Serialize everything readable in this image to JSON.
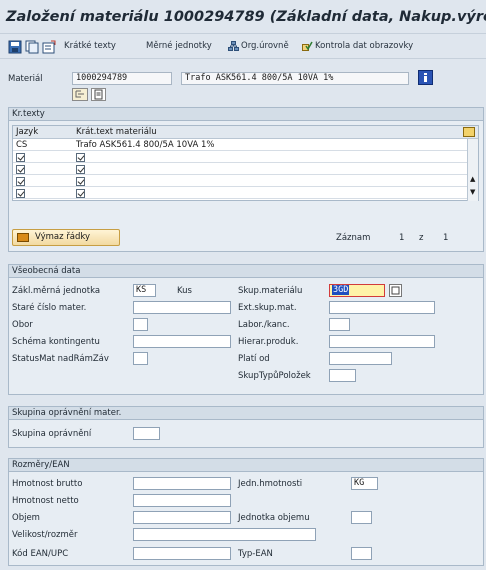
{
  "title": "Založení materiálu 1000294789 (Základní data, Nakup.výrobky a ma",
  "toolbar": {
    "short_texts": "Krátké texty",
    "units": "Měrné jednotky",
    "org_levels": "Org.úrovně",
    "check_screen_data": "Kontrola dat obrazovky"
  },
  "material": {
    "label": "Materiál",
    "number": "1000294789",
    "description": "Trafo ASK561.4 800/5A 10VA  1%"
  },
  "short_texts": {
    "group_title": "Kr.texty",
    "col_language": "Jazyk",
    "col_text": "Krát.text materiálu",
    "rows": [
      {
        "lang": "CS",
        "text": "Trafo ASK561.4 800/5A 10VA  1%"
      },
      {
        "lang": "",
        "text": ""
      },
      {
        "lang": "",
        "text": ""
      },
      {
        "lang": "",
        "text": ""
      }
    ],
    "delete_button": "Výmaz řádky",
    "record_label": "Záznam",
    "record_current": "1",
    "record_of": "z",
    "record_total": "1"
  },
  "general": {
    "group_title": "Všeobecná data",
    "base_uom_label": "Zákl.měrná jednotka",
    "base_uom_value": "KS",
    "base_uom_text": "Kus",
    "old_material_label": "Staré číslo mater.",
    "division_label": "Obor",
    "quota_label": "Schéma kontingentu",
    "status_label": "StatusMat nadRámZáv",
    "material_group_label": "Skup.materiálu",
    "material_group_value": "3GD",
    "ext_group_label": "Ext.skup.mat.",
    "lab_label": "Labor./kanc.",
    "hierarchy_label": "Hierar.produk.",
    "valid_from_label": "Platí od",
    "item_cat_group_label": "SkupTypůPoložek"
  },
  "authorization": {
    "group_title": "Skupina oprávnění mater.",
    "auth_group_label": "Skupina oprávnění"
  },
  "dimensions": {
    "group_title": "Rozměry/EAN",
    "gross_weight_label": "Hmotnost brutto",
    "net_weight_label": "Hmotnost netto",
    "volume_label": "Objem",
    "size_label": "Velikost/rozměr",
    "ean_label": "Kód EAN/UPC",
    "weight_unit_label": "Jedn.hmotnosti",
    "weight_unit_value": "KG",
    "volume_unit_label": "Jednotka objemu",
    "ean_type_label": "Typ-EAN"
  },
  "colors": {
    "background": "#dfe6ee",
    "group_title_bg": "#d3dde7",
    "focus_field_bg": "#fff3a8",
    "focus_border": "#d23b3b",
    "info_button": "#2a53b4",
    "delete_button_icon": "#d88a18"
  }
}
